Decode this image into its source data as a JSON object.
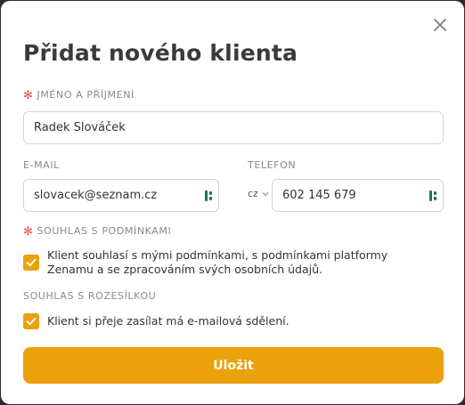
{
  "dialog": {
    "title": "Přidat nového klienta",
    "accent_color": "#eba10a",
    "required_color": "#e5534b"
  },
  "fields": {
    "name": {
      "label": "JMÉNO A PŘÍJMENÍ",
      "value": "Radek Slováček",
      "required": true
    },
    "email": {
      "label": "E-MAIL",
      "value": "slovacek@seznam.cz",
      "icon": "password-manager-icon"
    },
    "phone": {
      "label": "TELEFON",
      "country_code": "cz",
      "value": "602 145 679",
      "icon": "password-manager-icon"
    }
  },
  "consent_terms": {
    "label": "SOUHLAS S PODMÍNKAMI",
    "required": true,
    "checked": true,
    "text_line1": "Klient souhlasí s mými podmínkami, s podmínkami platformy",
    "text_line2": "Zenamu a se zpracováním svých osobních údajů."
  },
  "consent_newsletter": {
    "label": "SOUHLAS S ROZESÍLKOU",
    "checked": true,
    "text": "Klient si přeje zasílat má e-mailová sdělení."
  },
  "actions": {
    "submit_label": "Uložit",
    "close_icon": "close-icon"
  }
}
